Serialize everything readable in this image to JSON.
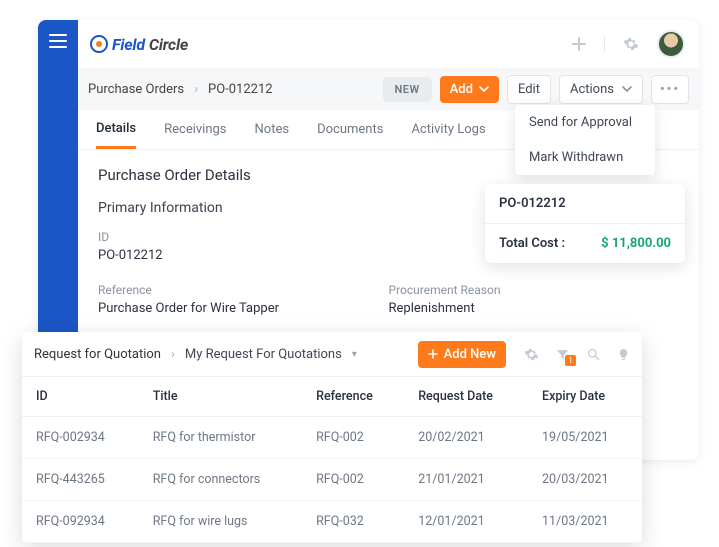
{
  "brand": {
    "field": "Field",
    "circle": "Circle"
  },
  "breadcrumb": {
    "root": "Purchase Orders",
    "current": "PO-012212"
  },
  "toolbar": {
    "status": "NEW",
    "add": "Add",
    "edit": "Edit",
    "actions": "Actions",
    "more": "•••"
  },
  "actions_menu": {
    "items": [
      {
        "label": "Send for Approval"
      },
      {
        "label": "Mark Withdrawn"
      }
    ]
  },
  "tabs": [
    {
      "label": "Details",
      "active": true
    },
    {
      "label": "Receivings"
    },
    {
      "label": "Notes"
    },
    {
      "label": "Documents"
    },
    {
      "label": "Activity Logs"
    }
  ],
  "section": {
    "title": "Purchase Order Details",
    "subtitle": "Primary Information",
    "id_label": "ID",
    "id_value": "PO-012212",
    "ref_label": "Reference",
    "ref_value": "Purchase Order for Wire Tapper",
    "reason_label": "Procurement Reason",
    "reason_value": "Replenishment"
  },
  "summary": {
    "title": "PO-012212",
    "cost_label": "Total Cost :",
    "cost_value": "$ 11,800.00"
  },
  "rfq": {
    "breadcrumb_root": "Request for Quotation",
    "breadcrumb_current": "My Request For Quotations",
    "add_new": "Add New",
    "filter_count": "1",
    "columns": {
      "id": "ID",
      "title": "Title",
      "reference": "Reference",
      "request_date": "Request Date",
      "expiry_date": "Expiry Date"
    },
    "rows": [
      {
        "id": "RFQ-002934",
        "title": "RFQ for thermistor",
        "reference": "RFQ-002",
        "request_date": "20/02/2021",
        "expiry_date": "19/05/2021"
      },
      {
        "id": "RFQ-443265",
        "title": "RFQ for connectors",
        "reference": "RFQ-002",
        "request_date": "21/01/2021",
        "expiry_date": "20/03/2021"
      },
      {
        "id": "RFQ-092934",
        "title": "RFQ for wire lugs",
        "reference": "RFQ-032",
        "request_date": "12/01/2021",
        "expiry_date": "11/03/2021"
      }
    ]
  },
  "chart_data": {
    "type": "table",
    "title": "My Request For Quotations",
    "columns": [
      "ID",
      "Title",
      "Reference",
      "Request Date",
      "Expiry Date"
    ],
    "rows": [
      [
        "RFQ-002934",
        "RFQ for thermistor",
        "RFQ-002",
        "20/02/2021",
        "19/05/2021"
      ],
      [
        "RFQ-443265",
        "RFQ for connectors",
        "RFQ-002",
        "21/01/2021",
        "20/03/2021"
      ],
      [
        "RFQ-092934",
        "RFQ for wire lugs",
        "RFQ-032",
        "12/01/2021",
        "11/03/2021"
      ]
    ]
  }
}
